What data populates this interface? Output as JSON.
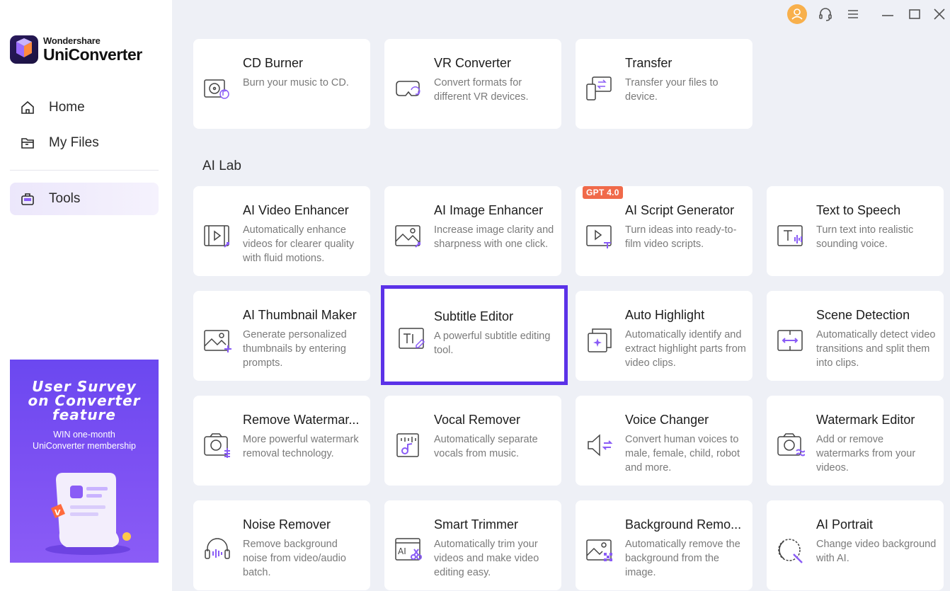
{
  "app": {
    "brand": "Wondershare",
    "product": "UniConverter"
  },
  "nav": {
    "home": "Home",
    "my_files": "My Files",
    "tools": "Tools"
  },
  "banner": {
    "title": "User Survey\non Converter\nfeature",
    "subtitle": "WIN one-month\nUniConverter membership"
  },
  "top_tools": [
    {
      "title": "CD Burner",
      "desc": "Burn your music to CD.",
      "icon": "cd-icon"
    },
    {
      "title": "VR Converter",
      "desc": "Convert formats for different VR devices.",
      "icon": "vr-headset-icon"
    },
    {
      "title": "Transfer",
      "desc": "Transfer your files to device.",
      "icon": "transfer-device-icon"
    }
  ],
  "ai_lab": {
    "title": "AI Lab",
    "badge": "GPT 4.0",
    "tools": [
      {
        "title": "AI Video Enhancer",
        "desc": "Automatically enhance videos for clearer quality with fluid motions.",
        "icon": "video-enhance-icon"
      },
      {
        "title": "AI Image Enhancer",
        "desc": "Increase image clarity and sharpness with one click.",
        "icon": "image-enhance-icon"
      },
      {
        "title": "AI Script Generator",
        "desc": "Turn ideas into ready-to-film video scripts.",
        "icon": "script-generator-icon"
      },
      {
        "title": "Text to Speech",
        "desc": "Turn text into realistic sounding voice.",
        "icon": "text-to-speech-icon"
      },
      {
        "title": "AI Thumbnail Maker",
        "desc": "Generate personalized thumbnails by entering prompts.",
        "icon": "thumbnail-maker-icon"
      },
      {
        "title": "Subtitle Editor",
        "desc": "A powerful subtitle editing tool.",
        "icon": "subtitle-editor-icon"
      },
      {
        "title": "Auto Highlight",
        "desc": "Automatically identify and extract highlight parts from video clips.",
        "icon": "auto-highlight-icon"
      },
      {
        "title": "Scene Detection",
        "desc": "Automatically detect video transitions and split them into clips.",
        "icon": "scene-detection-icon"
      },
      {
        "title": "Remove Watermar...",
        "desc": "More powerful watermark removal technology.",
        "icon": "remove-watermark-icon"
      },
      {
        "title": "Vocal Remover",
        "desc": "Automatically separate vocals from music.",
        "icon": "vocal-remover-icon"
      },
      {
        "title": "Voice Changer",
        "desc": "Convert human voices to male, female, child, robot and more.",
        "icon": "voice-changer-icon"
      },
      {
        "title": "Watermark Editor",
        "desc": "Add or remove watermarks from your videos.",
        "icon": "watermark-editor-icon"
      },
      {
        "title": "Noise Remover",
        "desc": "Remove background noise from video/audio batch.",
        "icon": "noise-remover-icon"
      },
      {
        "title": "Smart Trimmer",
        "desc": "Automatically trim your videos and make video editing easy.",
        "icon": "smart-trimmer-icon"
      },
      {
        "title": "Background Remo...",
        "desc": "Automatically remove the background from the image.",
        "icon": "background-remover-icon"
      },
      {
        "title": "AI Portrait",
        "desc": "Change video background with AI.",
        "icon": "ai-portrait-icon"
      }
    ]
  },
  "colors": {
    "accent": "#5b32e8",
    "icon_purple": "#8a5cf6",
    "badge": "#f06a4a",
    "avatar": "#f8b04c"
  }
}
